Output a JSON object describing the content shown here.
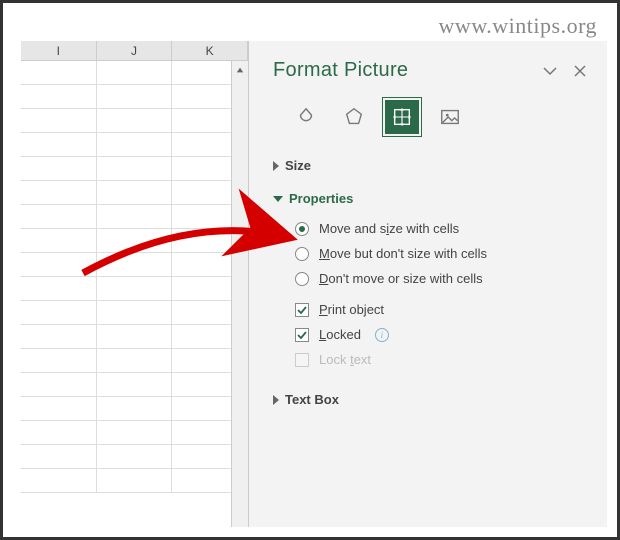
{
  "watermark": "www.wintips.org",
  "sheet": {
    "columns": [
      "I",
      "J",
      "K"
    ]
  },
  "panel": {
    "title": "Format Picture",
    "tabs": {
      "fill": "fill-line",
      "effects": "effects",
      "size": "size-properties",
      "picture": "picture"
    },
    "sections": {
      "size": {
        "label": "Size",
        "expanded": false
      },
      "properties": {
        "label": "Properties",
        "expanded": true,
        "radios": [
          {
            "id": "move-size",
            "label_pre": "Move and s",
            "label_u": "i",
            "label_post": "ze with cells",
            "selected": true
          },
          {
            "id": "move-no-size",
            "label_pre": "",
            "label_u": "M",
            "label_post": "ove but don't size with cells",
            "selected": false
          },
          {
            "id": "no-move-size",
            "label_pre": "",
            "label_u": "D",
            "label_post": "on't move or size with cells",
            "selected": false
          }
        ],
        "checks": [
          {
            "id": "print",
            "label_pre": "",
            "label_u": "P",
            "label_post": "rint object",
            "checked": true,
            "disabled": false,
            "info": false
          },
          {
            "id": "locked",
            "label_pre": "",
            "label_u": "L",
            "label_post": "ocked",
            "checked": true,
            "disabled": false,
            "info": true
          },
          {
            "id": "locktext",
            "label_pre": "Lock ",
            "label_u": "t",
            "label_post": "ext",
            "checked": false,
            "disabled": true,
            "info": false
          }
        ]
      },
      "textbox": {
        "label": "Text Box",
        "expanded": false
      }
    }
  }
}
